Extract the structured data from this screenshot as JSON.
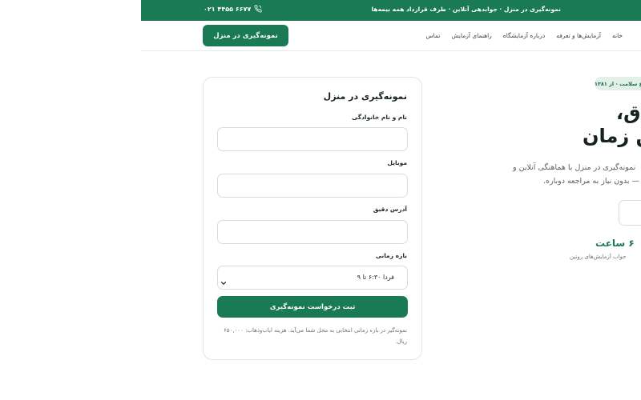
{
  "topbar": {
    "message": "نمونه‌گیری در منزل · جوابدهی آنلاین · طرف قرارداد همه بیمه‌ها",
    "phone": "۰۲۱ ۴۴۵۵ ۶۶۷۷",
    "phone_icon": "phone-icon"
  },
  "nav": {
    "links": [
      "خانه",
      "آزمایش‌ها و تعرفه",
      "درباره آزمایشگاه",
      "راهنمای آزمایش",
      "تماس"
    ],
    "cta_label": "نمونه‌گیری در منزل"
  },
  "hero": {
    "badge": "ع سلامت · از ۱۳۸۱",
    "title_line1": "ق،",
    "title_line2": "ین زمان",
    "desc_line1": "نمونه‌گیری در منزل با هماهنگی آنلاین و",
    "desc_line2": "ی — بدون نیاز به مراجعه دوباره.",
    "stat_value": "۶ ساعت",
    "stat_label": "جواب آزمایش‌های روتین"
  },
  "form": {
    "title": "نمونه‌گیری در منزل",
    "name_label": "نام و نام خانوادگی",
    "name_value": "",
    "mobile_label": "موبایل",
    "mobile_value": "",
    "address_label": "آدرس دقیق",
    "address_value": "",
    "time_label": "بازه زمانی",
    "time_selected": "فردا ۶:۳۰ تا ۹",
    "submit_label": "ثبت درخواست نمونه‌گیری",
    "note": "نمونه‌گیر در بازه زمانی انتخابی به محل شما می‌آید. هزینه ایاب‌وذهاب: ۶۵۰,۰۰۰ ریال."
  },
  "colors": {
    "primary": "#1a7a55",
    "badge_bg": "#e3efe9",
    "border": "#d6dedb"
  }
}
